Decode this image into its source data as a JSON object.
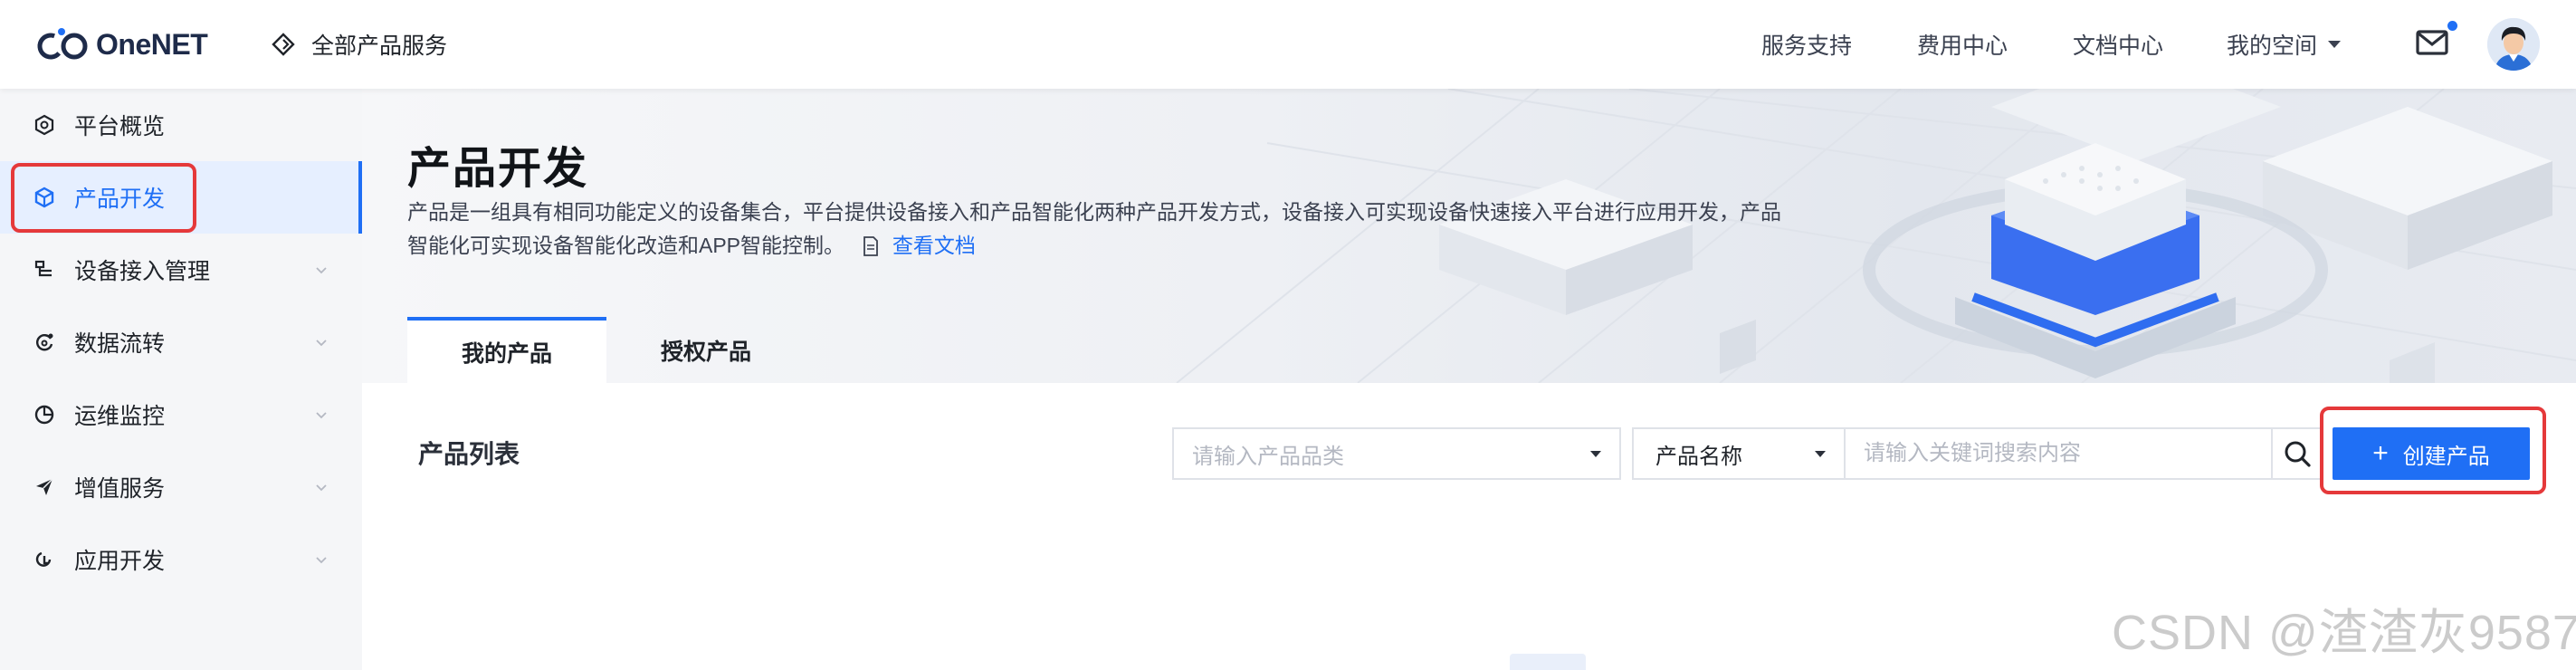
{
  "header": {
    "logo_text": "OneNET",
    "all_products": "全部产品服务",
    "nav": [
      "服务支持",
      "费用中心",
      "文档中心"
    ],
    "my_space": "我的空间",
    "mail_icon": "mail-icon",
    "has_unread": true
  },
  "sidebar": {
    "items": [
      {
        "label": "平台概览",
        "icon": "hexagon-icon",
        "expandable": false,
        "active": false
      },
      {
        "label": "产品开发",
        "icon": "cube-icon",
        "expandable": false,
        "active": true
      },
      {
        "label": "设备接入管理",
        "icon": "device-list-icon",
        "expandable": true,
        "active": false
      },
      {
        "label": "数据流转",
        "icon": "data-flow-icon",
        "expandable": true,
        "active": false
      },
      {
        "label": "运维监控",
        "icon": "monitor-chart-icon",
        "expandable": true,
        "active": false
      },
      {
        "label": "增值服务",
        "icon": "plane-icon",
        "expandable": true,
        "active": false
      },
      {
        "label": "应用开发",
        "icon": "app-dev-icon",
        "expandable": true,
        "active": false
      }
    ]
  },
  "hero": {
    "title": "产品开发",
    "desc_line1": "产品是一组具有相同功能定义的设备集合，平台提供设备接入和产品智能化两种产品开发方式，设备接入可实现设备快速接入平台进行应用开发，产品",
    "desc_line2": "智能化可实现设备智能化改造和APP智能控制。",
    "doc_link": "查看文档",
    "tabs": [
      {
        "label": "我的产品",
        "active": true
      },
      {
        "label": "授权产品",
        "active": false
      }
    ]
  },
  "product_list": {
    "title": "产品列表",
    "category_placeholder": "请输入产品品类",
    "name_select": "产品名称",
    "keyword_placeholder": "请输入关键词搜索内容",
    "create_button": "创建产品"
  },
  "watermark": "CSDN @渣渣灰9587",
  "colors": {
    "primary": "#1f6ff5",
    "highlight_box": "#e5393a",
    "sidebar_bg": "#f5f6f8",
    "active_bg": "#e6efff"
  }
}
